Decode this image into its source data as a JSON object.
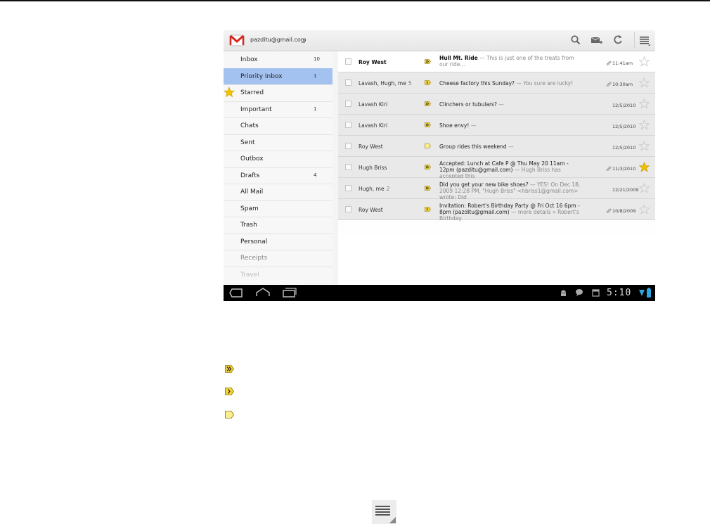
{
  "header": {
    "account": "pazditu@gmail.com"
  },
  "toolbar": {
    "search_icon": "search-icon",
    "compose_icon": "compose-icon",
    "refresh_icon": "refresh-icon",
    "menu_icon": "overflow-menu-icon"
  },
  "sidebar": {
    "items": [
      {
        "label": "Inbox",
        "count": "10"
      },
      {
        "label": "Priority Inbox",
        "count": "1"
      },
      {
        "label": "Starred",
        "count": ""
      },
      {
        "label": "Important",
        "count": "1"
      },
      {
        "label": "Chats",
        "count": ""
      },
      {
        "label": "Sent",
        "count": ""
      },
      {
        "label": "Outbox",
        "count": ""
      },
      {
        "label": "Drafts",
        "count": "4"
      },
      {
        "label": "All Mail",
        "count": ""
      },
      {
        "label": "Spam",
        "count": ""
      },
      {
        "label": "Trash",
        "count": ""
      },
      {
        "label": "Personal",
        "count": ""
      },
      {
        "label": "Receipts",
        "count": ""
      },
      {
        "label": "Travel",
        "count": ""
      }
    ]
  },
  "messages": [
    {
      "from": "Roy West",
      "thread": "",
      "subject": "Hull Mt. Ride",
      "snippet": "— This is just one of the treats from our ride...",
      "time": "11:41am",
      "marker": "double",
      "attachment": true,
      "starred": false,
      "unread": true
    },
    {
      "from": "Lavash, Hugh, me",
      "thread": "5",
      "subject": "Cheese factory this Sunday?",
      "snippet": "— You sure are lucky!",
      "time": "10:30am",
      "marker": "single",
      "attachment": true,
      "starred": false,
      "unread": false
    },
    {
      "from": "Lavash Kiri",
      "thread": "",
      "subject": "Clinchers or tubulars?",
      "snippet": "—",
      "time": "12/5/2010",
      "marker": "double",
      "attachment": false,
      "starred": false,
      "unread": false
    },
    {
      "from": "Lavash Kiri",
      "thread": "",
      "subject": "Shoe envy!",
      "snippet": "—",
      "time": "12/5/2010",
      "marker": "double",
      "attachment": false,
      "starred": false,
      "unread": false
    },
    {
      "from": "Roy West",
      "thread": "",
      "subject": "Group rides this weekend",
      "snippet": "—",
      "time": "12/5/2010",
      "marker": "plain",
      "attachment": false,
      "starred": false,
      "unread": false
    },
    {
      "from": "Hugh Briss",
      "thread": "",
      "subject": "Accepted: Lunch at Cafe P @ Thu May 20 11am - 12pm (pazditu@gmail.com)",
      "snippet": "— Hugh Briss has accepted this",
      "time": "11/3/2010",
      "marker": "double",
      "attachment": true,
      "starred": true,
      "unread": false
    },
    {
      "from": "Hugh, me",
      "thread": "2",
      "subject": "Did you get your new bike shoes?",
      "snippet": "— YES! On Dec 18, 2009 12:28 PM, \"Hugh Briss\" <hbriss1@gmail.com> wrote: Did",
      "time": "12/21/2009",
      "marker": "double",
      "attachment": false,
      "starred": false,
      "unread": false
    },
    {
      "from": "Roy West",
      "thread": "",
      "subject": "Invitation: Robert's Birthday Party @ Fri Oct 16 6pm - 8pm (pazditu@gmail.com)",
      "snippet": "— more details » Robert's Birthday",
      "time": "10/8/2009",
      "marker": "single",
      "attachment": true,
      "starred": false,
      "unread": false
    }
  ],
  "sysbar": {
    "clock": "5:10"
  },
  "legend": {
    "markers": [
      "important-double-icon",
      "important-single-icon",
      "not-important-icon"
    ]
  },
  "colors": {
    "selected": "#a4c2ef",
    "marker_yellow": "#f4d533",
    "star_yellow": "#f2c200"
  }
}
